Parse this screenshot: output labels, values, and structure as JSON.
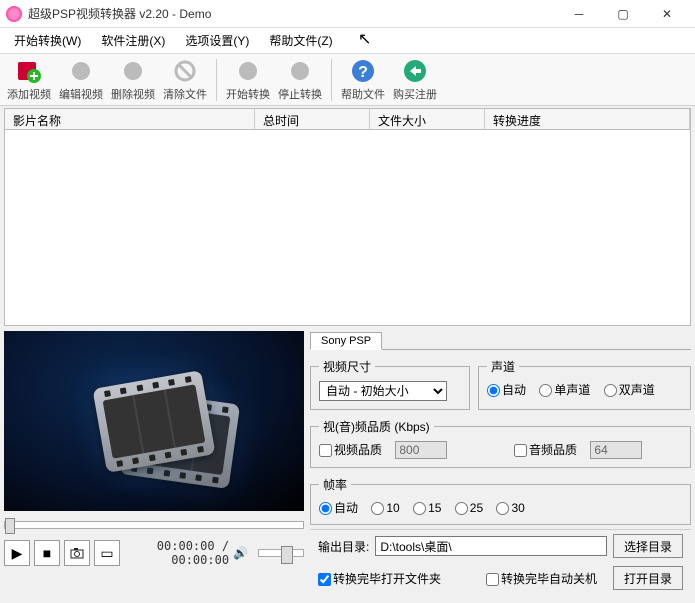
{
  "title": "超级PSP视频转换器 v2.20 - Demo",
  "menus": {
    "m0": "开始转换(W)",
    "m1": "软件注册(X)",
    "m2": "选项设置(Y)",
    "m3": "帮助文件(Z)"
  },
  "tools": {
    "t0": "添加视频",
    "t1": "编辑视频",
    "t2": "删除视频",
    "t3": "清除文件",
    "t4": "开始转换",
    "t5": "停止转换",
    "t6": "帮助文件",
    "t7": "购买注册"
  },
  "cols": {
    "c0": "影片名称",
    "c1": "总时间",
    "c2": "文件大小",
    "c3": "转换进度"
  },
  "time": "00:00:00 / 00:00:00",
  "tab": "Sony PSP",
  "labels": {
    "videosize": "视频尺寸",
    "channel": "声道",
    "quality": "视(音)频品质 (Kbps)",
    "vq": "视频品质",
    "aq": "音频品质",
    "fps": "帧率",
    "outdir": "输出目录:",
    "browse": "选择目录",
    "opendir": "打开目录",
    "cb1": "转换完毕打开文件夹",
    "cb2": "转换完毕自动关机"
  },
  "videosize_opt": "自动 - 初始大小",
  "chan": {
    "auto": "自动",
    "mono": "单声道",
    "stereo": "双声道"
  },
  "vkbps": "800",
  "akbps": "64",
  "fps": {
    "auto": "自动",
    "v10": "10",
    "v15": "15",
    "v25": "25",
    "v30": "30"
  },
  "outpath": "D:\\tools\\桌面\\"
}
